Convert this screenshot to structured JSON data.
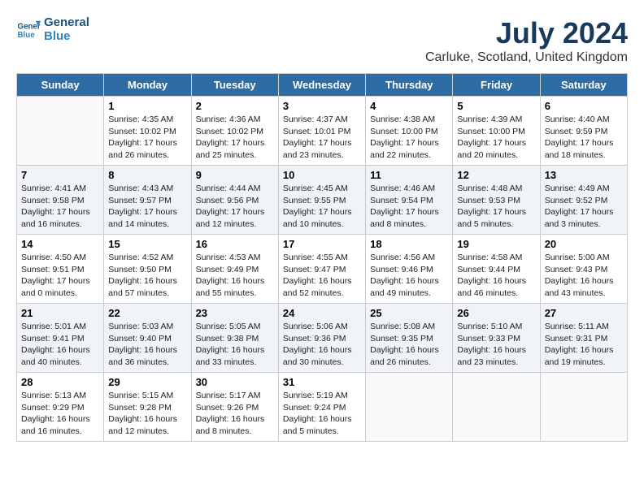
{
  "header": {
    "logo_line1": "General",
    "logo_line2": "Blue",
    "month": "July 2024",
    "location": "Carluke, Scotland, United Kingdom"
  },
  "days_of_week": [
    "Sunday",
    "Monday",
    "Tuesday",
    "Wednesday",
    "Thursday",
    "Friday",
    "Saturday"
  ],
  "weeks": [
    [
      {
        "day": "",
        "info": ""
      },
      {
        "day": "1",
        "info": "Sunrise: 4:35 AM\nSunset: 10:02 PM\nDaylight: 17 hours\nand 26 minutes."
      },
      {
        "day": "2",
        "info": "Sunrise: 4:36 AM\nSunset: 10:02 PM\nDaylight: 17 hours\nand 25 minutes."
      },
      {
        "day": "3",
        "info": "Sunrise: 4:37 AM\nSunset: 10:01 PM\nDaylight: 17 hours\nand 23 minutes."
      },
      {
        "day": "4",
        "info": "Sunrise: 4:38 AM\nSunset: 10:00 PM\nDaylight: 17 hours\nand 22 minutes."
      },
      {
        "day": "5",
        "info": "Sunrise: 4:39 AM\nSunset: 10:00 PM\nDaylight: 17 hours\nand 20 minutes."
      },
      {
        "day": "6",
        "info": "Sunrise: 4:40 AM\nSunset: 9:59 PM\nDaylight: 17 hours\nand 18 minutes."
      }
    ],
    [
      {
        "day": "7",
        "info": "Sunrise: 4:41 AM\nSunset: 9:58 PM\nDaylight: 17 hours\nand 16 minutes."
      },
      {
        "day": "8",
        "info": "Sunrise: 4:43 AM\nSunset: 9:57 PM\nDaylight: 17 hours\nand 14 minutes."
      },
      {
        "day": "9",
        "info": "Sunrise: 4:44 AM\nSunset: 9:56 PM\nDaylight: 17 hours\nand 12 minutes."
      },
      {
        "day": "10",
        "info": "Sunrise: 4:45 AM\nSunset: 9:55 PM\nDaylight: 17 hours\nand 10 minutes."
      },
      {
        "day": "11",
        "info": "Sunrise: 4:46 AM\nSunset: 9:54 PM\nDaylight: 17 hours\nand 8 minutes."
      },
      {
        "day": "12",
        "info": "Sunrise: 4:48 AM\nSunset: 9:53 PM\nDaylight: 17 hours\nand 5 minutes."
      },
      {
        "day": "13",
        "info": "Sunrise: 4:49 AM\nSunset: 9:52 PM\nDaylight: 17 hours\nand 3 minutes."
      }
    ],
    [
      {
        "day": "14",
        "info": "Sunrise: 4:50 AM\nSunset: 9:51 PM\nDaylight: 17 hours\nand 0 minutes."
      },
      {
        "day": "15",
        "info": "Sunrise: 4:52 AM\nSunset: 9:50 PM\nDaylight: 16 hours\nand 57 minutes."
      },
      {
        "day": "16",
        "info": "Sunrise: 4:53 AM\nSunset: 9:49 PM\nDaylight: 16 hours\nand 55 minutes."
      },
      {
        "day": "17",
        "info": "Sunrise: 4:55 AM\nSunset: 9:47 PM\nDaylight: 16 hours\nand 52 minutes."
      },
      {
        "day": "18",
        "info": "Sunrise: 4:56 AM\nSunset: 9:46 PM\nDaylight: 16 hours\nand 49 minutes."
      },
      {
        "day": "19",
        "info": "Sunrise: 4:58 AM\nSunset: 9:44 PM\nDaylight: 16 hours\nand 46 minutes."
      },
      {
        "day": "20",
        "info": "Sunrise: 5:00 AM\nSunset: 9:43 PM\nDaylight: 16 hours\nand 43 minutes."
      }
    ],
    [
      {
        "day": "21",
        "info": "Sunrise: 5:01 AM\nSunset: 9:41 PM\nDaylight: 16 hours\nand 40 minutes."
      },
      {
        "day": "22",
        "info": "Sunrise: 5:03 AM\nSunset: 9:40 PM\nDaylight: 16 hours\nand 36 minutes."
      },
      {
        "day": "23",
        "info": "Sunrise: 5:05 AM\nSunset: 9:38 PM\nDaylight: 16 hours\nand 33 minutes."
      },
      {
        "day": "24",
        "info": "Sunrise: 5:06 AM\nSunset: 9:36 PM\nDaylight: 16 hours\nand 30 minutes."
      },
      {
        "day": "25",
        "info": "Sunrise: 5:08 AM\nSunset: 9:35 PM\nDaylight: 16 hours\nand 26 minutes."
      },
      {
        "day": "26",
        "info": "Sunrise: 5:10 AM\nSunset: 9:33 PM\nDaylight: 16 hours\nand 23 minutes."
      },
      {
        "day": "27",
        "info": "Sunrise: 5:11 AM\nSunset: 9:31 PM\nDaylight: 16 hours\nand 19 minutes."
      }
    ],
    [
      {
        "day": "28",
        "info": "Sunrise: 5:13 AM\nSunset: 9:29 PM\nDaylight: 16 hours\nand 16 minutes."
      },
      {
        "day": "29",
        "info": "Sunrise: 5:15 AM\nSunset: 9:28 PM\nDaylight: 16 hours\nand 12 minutes."
      },
      {
        "day": "30",
        "info": "Sunrise: 5:17 AM\nSunset: 9:26 PM\nDaylight: 16 hours\nand 8 minutes."
      },
      {
        "day": "31",
        "info": "Sunrise: 5:19 AM\nSunset: 9:24 PM\nDaylight: 16 hours\nand 5 minutes."
      },
      {
        "day": "",
        "info": ""
      },
      {
        "day": "",
        "info": ""
      },
      {
        "day": "",
        "info": ""
      }
    ]
  ]
}
